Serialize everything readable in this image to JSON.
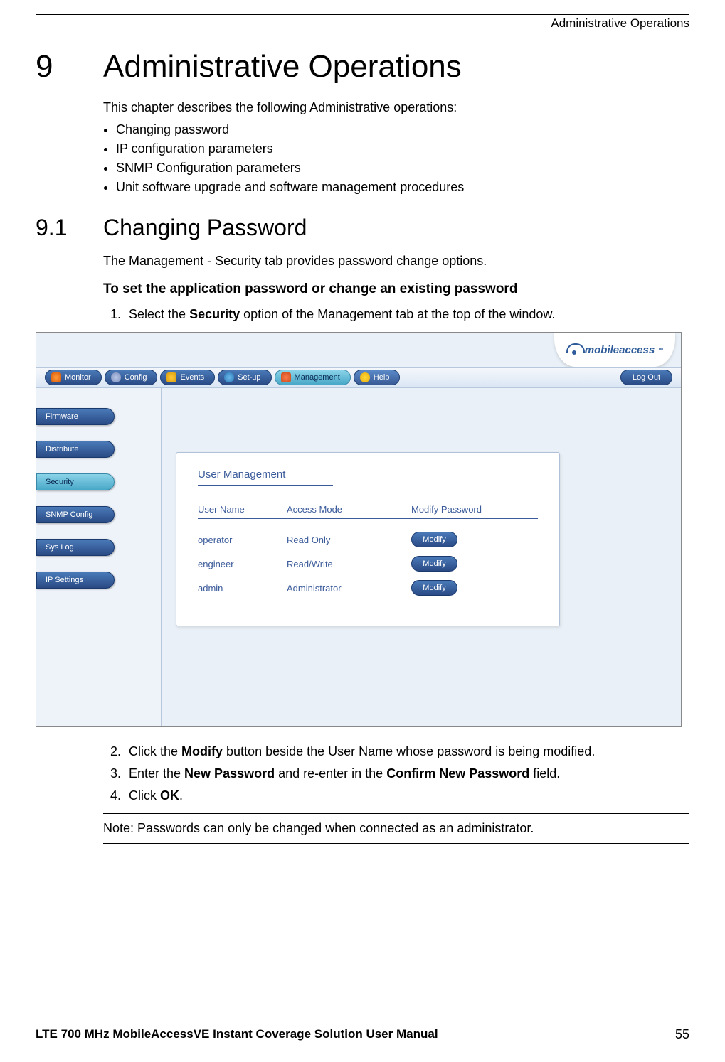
{
  "header": {
    "running_head": "Administrative Operations"
  },
  "chapter": {
    "number": "9",
    "title": "Administrative Operations",
    "intro": "This chapter describes the following Administrative operations:",
    "bullets": [
      "Changing password",
      "IP configuration parameters",
      "SNMP Configuration parameters",
      "Unit software upgrade and software management procedures"
    ]
  },
  "section": {
    "number": "9.1",
    "title": "Changing Password",
    "para": "The Management - Security tab provides password change options.",
    "subhead": "To set the application password or change an existing password",
    "step1_pre": "Select the ",
    "step1_bold": "Security",
    "step1_post": " option of the Management tab at the top of the window.",
    "step2_pre": "Click the ",
    "step2_bold": "Modify",
    "step2_post": " button beside the User Name whose password is being modified.",
    "step3_pre": "Enter the ",
    "step3_bold1": "New Password",
    "step3_mid": " and re-enter in the ",
    "step3_bold2": "Confirm New Password",
    "step3_post": " field.",
    "step4_pre": "Click ",
    "step4_bold": "OK",
    "step4_post": "."
  },
  "figure": {
    "logo": "mobileaccess",
    "nav": {
      "monitor": "Monitor",
      "config": "Config",
      "events": "Events",
      "setup": "Set-up",
      "management": "Management",
      "help": "Help",
      "logout": "Log Out"
    },
    "sidebar": [
      "Firmware",
      "Distribute",
      "Security",
      "SNMP Config",
      "Sys Log",
      "IP Settings"
    ],
    "panel": {
      "title": "User Management",
      "headers": {
        "username": "User Name",
        "access": "Access Mode",
        "modify": "Modify Password"
      },
      "rows": [
        {
          "user": "operator",
          "access": "Read Only",
          "btn": "Modify"
        },
        {
          "user": "engineer",
          "access": "Read/Write",
          "btn": "Modify"
        },
        {
          "user": "admin",
          "access": "Administrator",
          "btn": "Modify"
        }
      ]
    }
  },
  "note": "Note: Passwords can only be changed when connected as an administrator.",
  "footer": {
    "title": "LTE 700 MHz MobileAccessVE Instant Coverage Solution User Manual",
    "page": "55"
  }
}
